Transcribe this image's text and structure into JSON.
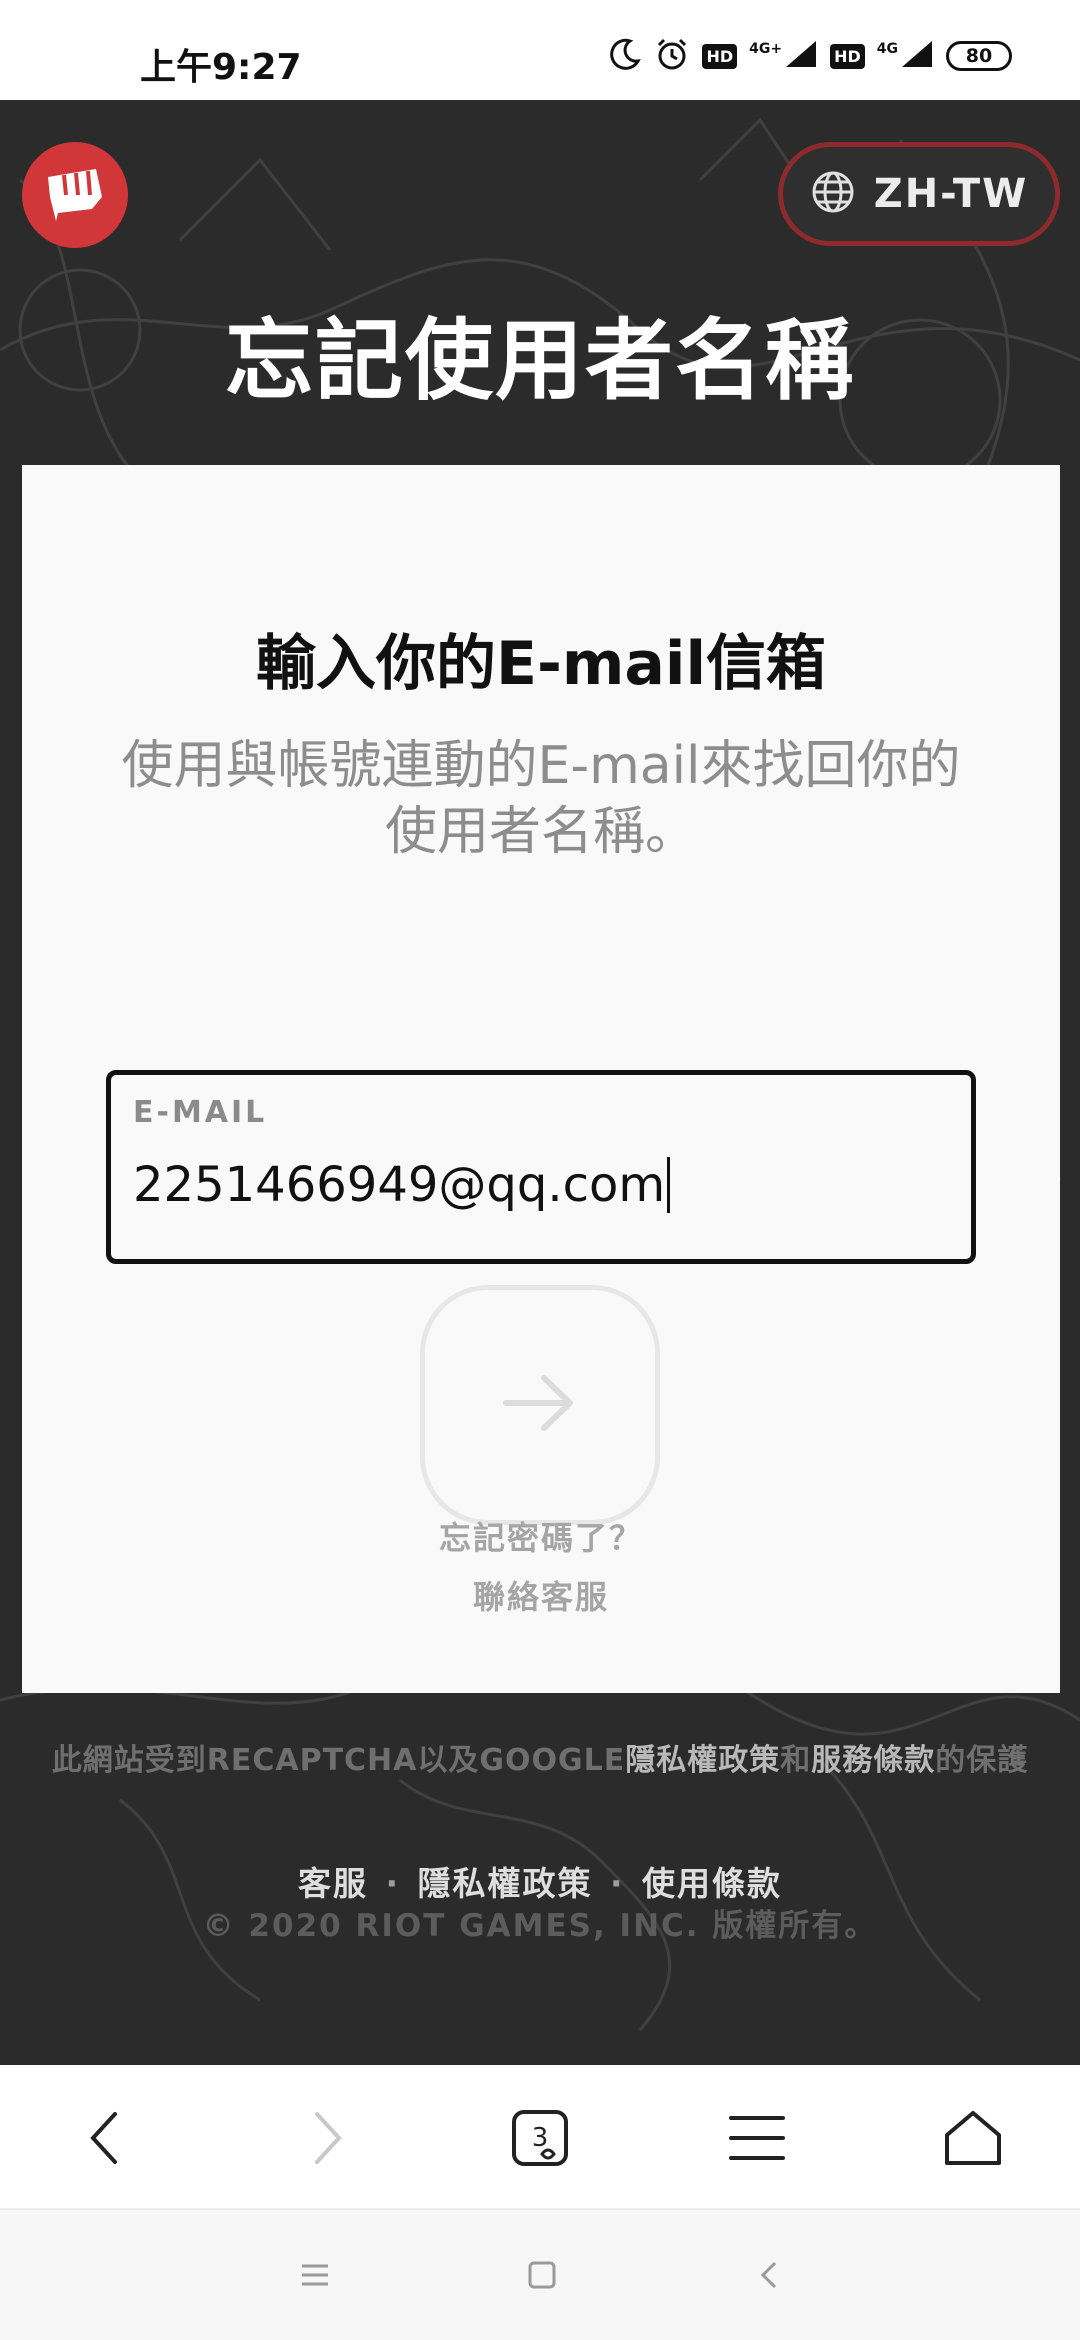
{
  "status_bar": {
    "time": "上午9:27",
    "hd_1": "HD",
    "net_1": "4G+",
    "hd_2": "HD",
    "net_2": "4G",
    "battery": "80"
  },
  "header": {
    "language_label": "ZH-TW",
    "brand_color": "#d13639"
  },
  "page_title": "忘記使用者名稱",
  "card": {
    "heading": "輸入你的E-mail信箱",
    "description": "使用與帳號連動的E-mail來找回你的使用者名稱。",
    "email_label": "E-MAIL",
    "email_value": "2251466949@qq.com",
    "forgot_password": "忘記密碼了？",
    "contact_support": "聯絡客服"
  },
  "recaptcha": {
    "prefix": "此網站受到RECAPTCHA以及GOOGLE",
    "privacy_link": "隱私權政策",
    "and": "和",
    "terms_link": "服務條款",
    "suffix": "的保護"
  },
  "footer": {
    "support": "客服",
    "sep": "·",
    "privacy": "隱私權政策",
    "terms": "使用條款",
    "copyright": "© 2020 RIOT GAMES, INC. 版權所有。"
  },
  "browser_bar": {
    "tab_count": "3"
  }
}
